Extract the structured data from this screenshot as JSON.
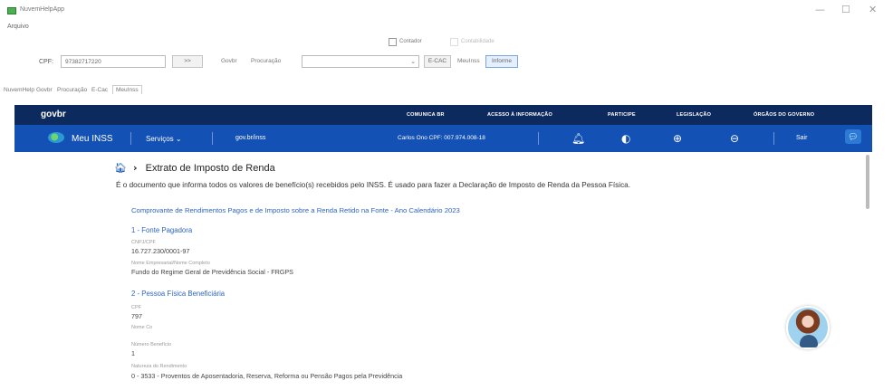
{
  "window": {
    "title": "NuvemHelpApp",
    "menu": "Arquivo",
    "controls": {
      "minimize": "—",
      "maximize": "☐",
      "close": "✕"
    }
  },
  "toolbar": {
    "checkbox_contador": "Contador",
    "checkbox_contabilidade": "Contabilidade",
    "cpf_label": "CPF:",
    "cpf_value": "97382717220",
    "more_button": ">>",
    "govbr_button": "Govbr",
    "procuracao_button": "Procuração",
    "ecac_button": "E-CAC",
    "meuinss_button": "MeuInss",
    "informe_button": "Informe"
  },
  "tabs": [
    {
      "label": "NuvemHelp"
    },
    {
      "label": "Govbr"
    },
    {
      "label": "Procuração"
    },
    {
      "label": "E-Cac"
    },
    {
      "label": "MeuInss"
    }
  ],
  "govbr": {
    "logo": "govbr",
    "links": [
      "COMUNICA BR",
      "ACESSO À INFORMAÇÃO",
      "PARTICIPE",
      "LEGISLAÇÃO",
      "ÓRGÃOS DO GOVERNO"
    ]
  },
  "inss_bar": {
    "app": "Meu INSS",
    "services": "Serviços",
    "site": "gov.br/inss",
    "user": "Carlos Ono CPF: 007.974.008-18",
    "exit": "Sair"
  },
  "page": {
    "breadcrumb": "Extrato de Imposto de Renda",
    "description": "É o documento que informa todos os valores de benefício(s) recebidos pelo INSS. É usado para fazer a Declaração de Imposto de Renda da Pessoa Física.",
    "comprovante_link": "Comprovante de Rendimentos Pagos e de Imposto sobre a Renda Retido na Fonte - Ano Calendário 2023",
    "section1": "1 - Fonte Pagadora",
    "cnpj_label": "CNPJ/CPF",
    "cnpj_value": "16.727.230/0001-97",
    "nome_empresarial_label": "Nome Empresarial/Nome Completo",
    "nome_empresarial_value": "Fundo do Regime Geral de Previdência Social - FRGPS",
    "section2": "2 - Pessoa Física Beneficiária",
    "cpf_label": "CPF",
    "cpf_value": "797",
    "nome_label": "Nome Co",
    "numero_beneficio_label": "Número Benefício",
    "numero_beneficio_value": "1",
    "natureza_label": "Natureza do Rendimento",
    "natureza_value": "0 - 3533 - Proventos de Aposentadoria, Reserva, Reforma ou Pensão Pagos pela Previdência"
  },
  "colors": {
    "gov_top": "#0d2a5e",
    "inss_blue": "#1351b4",
    "link_blue": "#2d66c3"
  },
  "icons": {
    "home": "house-icon",
    "bell": "bell-icon",
    "contrast": "contrast-icon",
    "zoom_in": "zoom-in-icon",
    "zoom_out": "zoom-out-icon",
    "chat": "chat-icon"
  }
}
